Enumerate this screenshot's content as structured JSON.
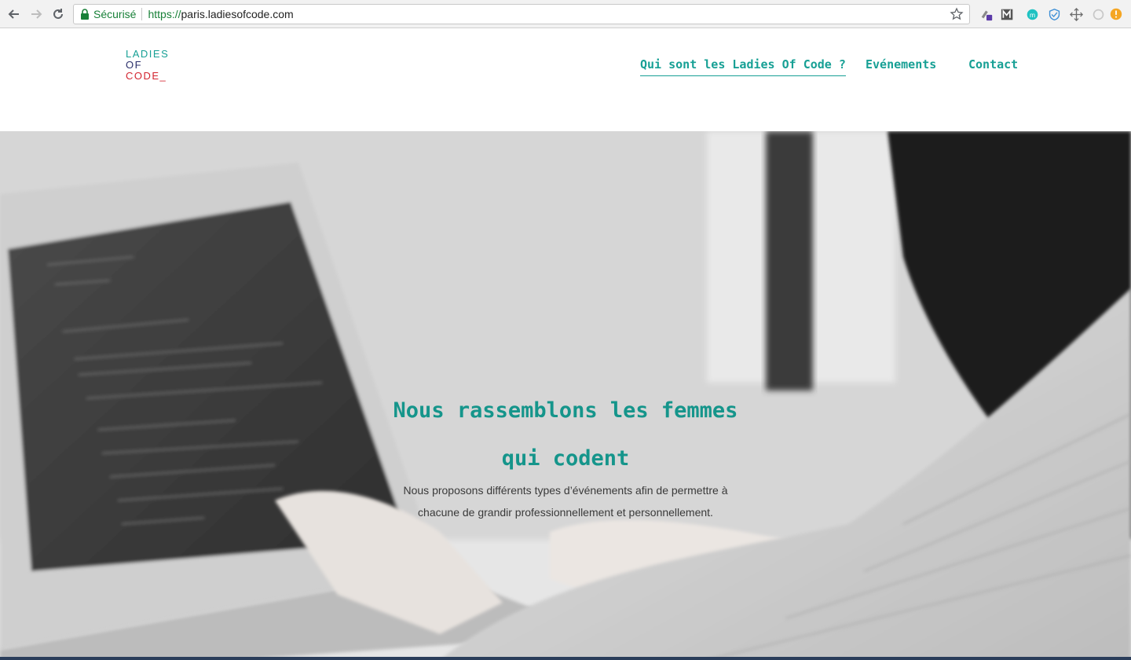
{
  "browser": {
    "secure_label": "Sécurisé",
    "url_protocol": "https://",
    "url_host": "paris.ladiesofcode.com",
    "extension_icons": [
      "extension-puzzle-icon",
      "m-extension-icon",
      "m-circle-extension-icon",
      "shield-extension-icon",
      "move-extension-icon",
      "refresh-extension-icon",
      "alert-extension-icon"
    ]
  },
  "logo": {
    "line1": "LADIES",
    "line2": "OF",
    "line3": "CODE_",
    "colors": {
      "ladies": "#17a095",
      "of": "#2a2f6b",
      "code": "#d32530"
    }
  },
  "nav": {
    "items": [
      {
        "label": "Qui sont les Ladies Of Code ?",
        "active": true
      },
      {
        "label": "Evénements",
        "active": false
      },
      {
        "label": "Contact",
        "active": false
      }
    ]
  },
  "hero": {
    "title_line1": "Nous rassemblons les femmes",
    "title_line2": "qui codent",
    "text_line1": "Nous proposons différents types d’événements afin de permettre à",
    "text_line2": "chacune de grandir professionnellement et personnellement."
  },
  "colors": {
    "accent": "#17a095",
    "secure_green": "#188038"
  }
}
